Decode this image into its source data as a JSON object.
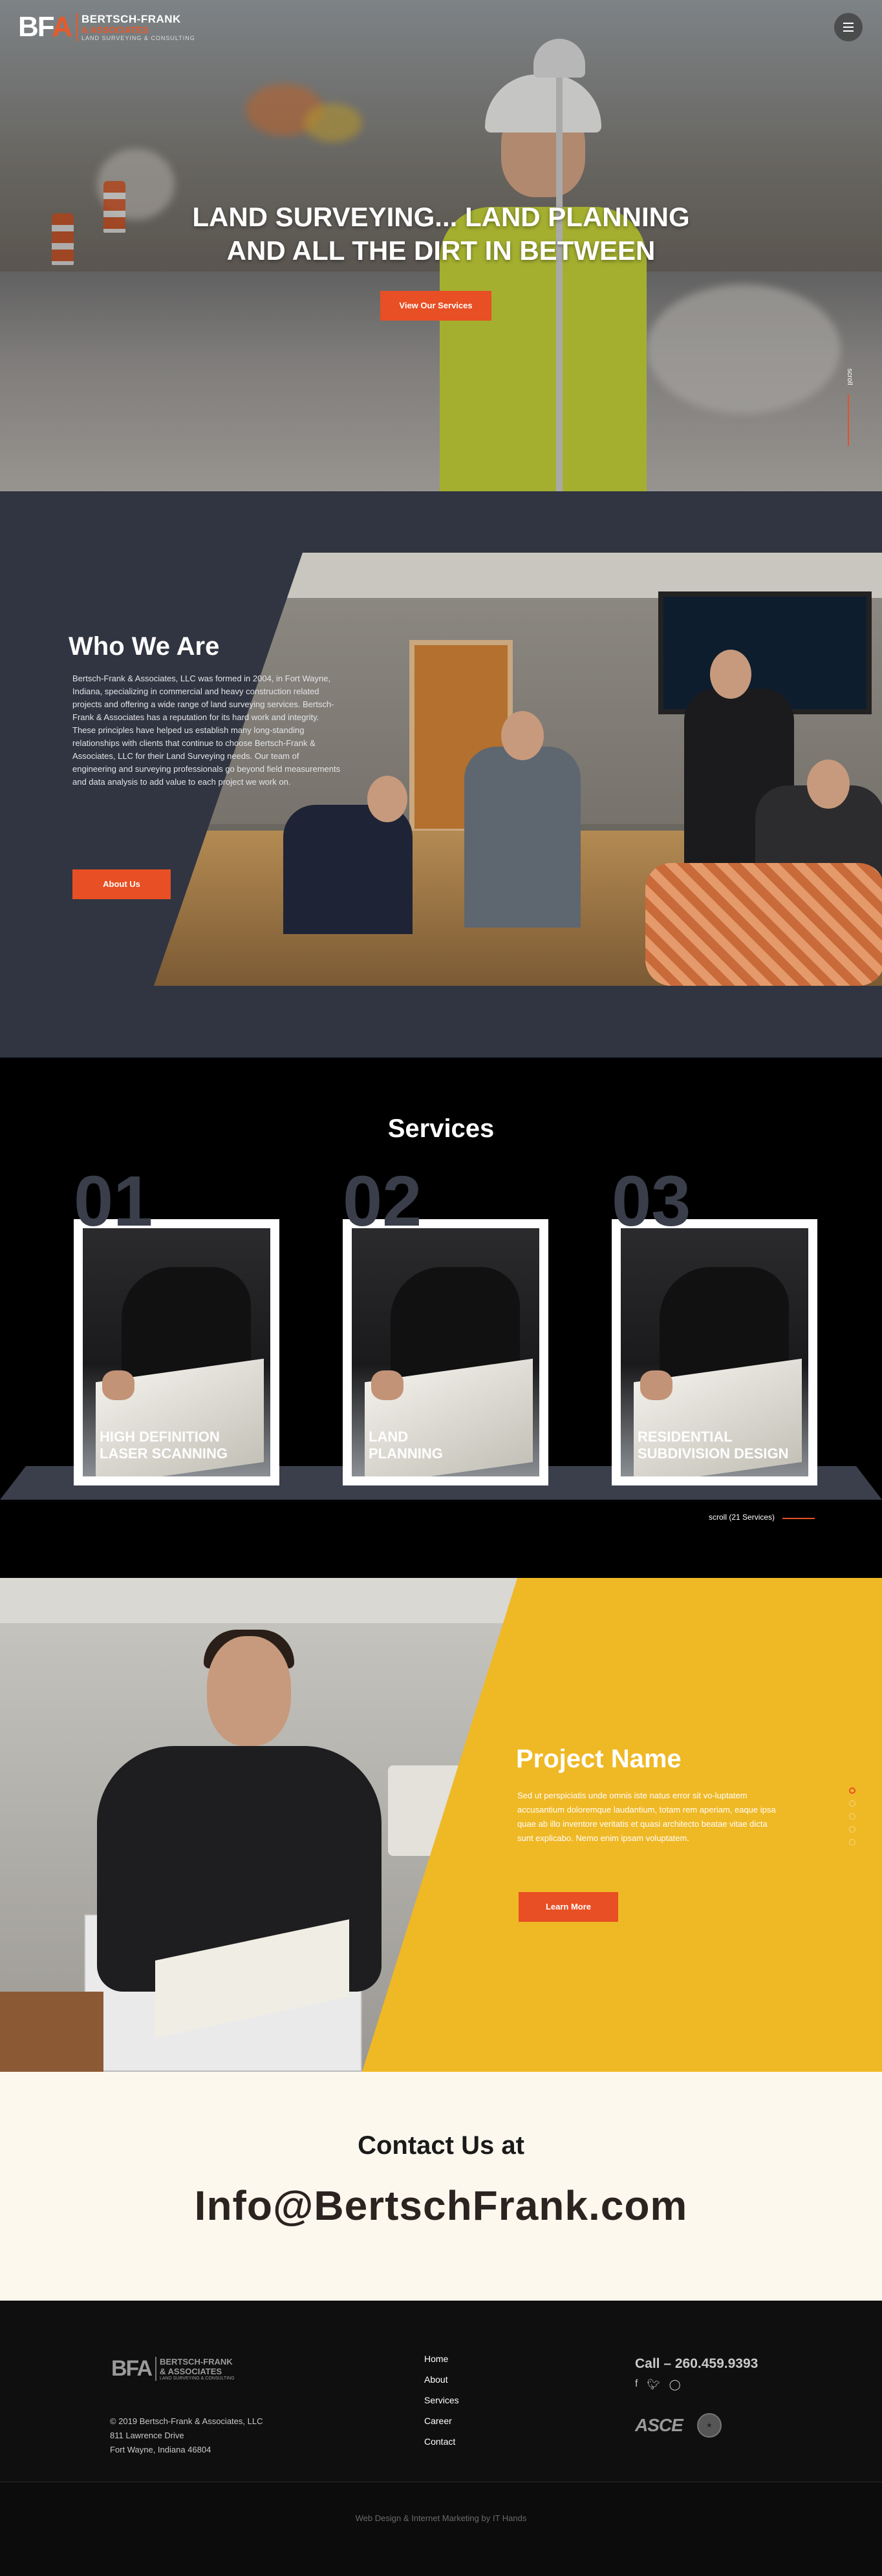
{
  "header": {
    "logo_mark": "BFA",
    "logo_line1": "BERTSCH-FRANK",
    "logo_line2": "& ASSOCIATES",
    "logo_line3": "LAND SURVEYING & CONSULTING",
    "menu_icon": "hamburger-icon"
  },
  "hero": {
    "title_line1": "LAND SURVEYING... LAND PLANNING",
    "title_line2": "AND ALL THE DIRT IN BETWEEN",
    "button_label": "View Our Services",
    "scroll_label": "scroll"
  },
  "who": {
    "title": "Who We Are",
    "body": "Bertsch-Frank & Associates, LLC was formed in 2004, in Fort Wayne, Indiana, specializing in commercial and heavy construction related projects and offering a wide range of land surveying services. Bertsch-Frank & Associates has a reputation for its hard work and integrity. These principles have helped us establish many long-standing relationships with clients that continue to choose Bertsch-Frank & Associates, LLC for their Land Surveying needs. Our team of engineering and surveying professionals go beyond field measurements and data analysis to add value to each project we work on.",
    "button_label": "About Us"
  },
  "services": {
    "title": "Services",
    "items": [
      {
        "num": "01",
        "label_line1": "HIGH DEFINITION",
        "label_line2": "LASER SCANNING"
      },
      {
        "num": "02",
        "label_line1": "LAND",
        "label_line2": "PLANNING"
      },
      {
        "num": "03",
        "label_line1": "RESIDENTIAL",
        "label_line2": "SUBDIVISION DESIGN"
      }
    ],
    "scroll_label": "scroll  (21 Services)"
  },
  "project": {
    "title": "Project Name",
    "body": "Sed ut perspiciatis unde omnis iste natus error sit vo-luptatem accusantium doloremque laudantium, totam rem aperiam, eaque ipsa quae ab illo inventore veritatis et quasi architecto beatae vitae dicta sunt explicabo. Nemo enim ipsam voluptatem.",
    "button_label": "Learn More",
    "accent_color": "#efb825"
  },
  "contact": {
    "title": "Contact Us at",
    "email": "Info@BertschFrank.com"
  },
  "footer": {
    "logo_mark": "BFA",
    "logo_line1": "BERTSCH-FRANK",
    "logo_line2": "& ASSOCIATES",
    "logo_line3": "LAND SURVEYING & CONSULTING",
    "copyright": "© 2019 Bertsch-Frank & Associates, LLC",
    "address1": "811 Lawrence Drive",
    "address2": "Fort Wayne, Indiana 46804",
    "links": [
      "Home",
      "About",
      "Services",
      "Career",
      "Contact"
    ],
    "call": "Call – 260.459.9393",
    "badge_text": "ASCE",
    "credit": "Web Design & Internet Marketing by IT Hands"
  },
  "colors": {
    "brand_orange": "#e84f24",
    "dark_slate": "#313541",
    "yellow": "#efb825",
    "cream": "#fdf8ee"
  }
}
